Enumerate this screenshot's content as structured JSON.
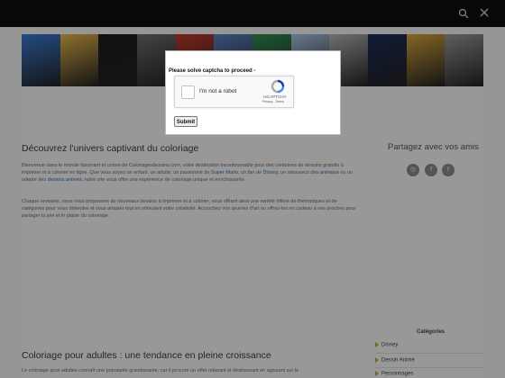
{
  "header": {
    "search_icon": "search-icon",
    "close_icon": "close-icon"
  },
  "banner": {
    "tile_colors": [
      "#3a7bd5",
      "#e8b64a",
      "#1b1b1b",
      "#6e6e6e",
      "#c0392b",
      "#5a84c4",
      "#2f8f4e",
      "#a9c6e8",
      "#b3b3b3",
      "#1c2c5a",
      "#d7a63a",
      "#9a9a9a"
    ]
  },
  "modal": {
    "message": "Please solve captcha to proceed -",
    "captcha_label": "I'm not a robot",
    "captcha_brand": "reCAPTCHA",
    "captcha_terms": "Privacy - Terms",
    "submit_label": "Submit"
  },
  "main": {
    "section1_title": "Découvrez l'univers captivant du coloriage",
    "p1_a": "Bienvenue dans le monde fascinant et coloré de Coloriagesdessins.com, votre destination incontournable pour des centaines de dessins gratuits à imprimer et à colorier en ligne. Que vous soyez un enfant, un adulte, un passionné de ",
    "p1_link1": "Super Mario",
    "p1_b": ", un fan de ",
    "p1_link2": "Disney",
    "p1_c": ", un amoureux des ",
    "p1_link3": "animaux",
    "p1_d": " ou un adepte des ",
    "p1_link4": "dessins animés",
    "p1_e": ", notre site vous offre une expérience de coloriage unique et enrichissante.",
    "p2": "Chaque semaine, nous vous proposons de nouveaux dessins à imprimer et à colorier, vous offrant ainsi une variété infinie de thématiques et de catégories pour vous détendre et vous amuser tout en stimulant votre créativité. Accrochez vos œuvres d'art ou offrez-les en cadeau à vos proches pour partager la joie et le plaisir du coloriage.",
    "section2_title": "Coloriage pour adultes : une tendance en pleine croissance",
    "p3": "Le coloriage pour adultes connaît une popularité grandissante, car il procure un effet relaxant et déstressant en agissant sur le"
  },
  "sidebar": {
    "share_title": "Partagez avec vos amis",
    "share_buttons": [
      "◎",
      "f",
      "t"
    ],
    "categories_title": "Catégories",
    "categories": [
      "Disney",
      "Dessin Animé",
      "Personnages"
    ]
  }
}
